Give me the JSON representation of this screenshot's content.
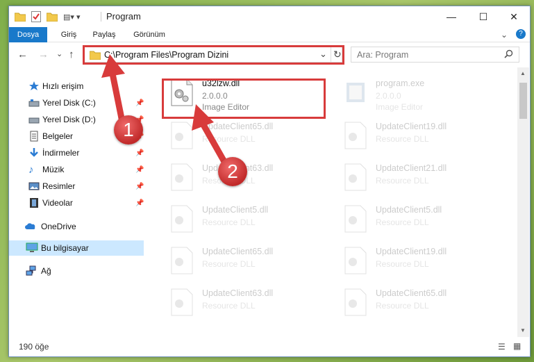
{
  "window": {
    "title": "Program",
    "controls": {
      "minimize": "—",
      "maximize": "☐",
      "close": "✕"
    }
  },
  "ribbon": {
    "tabs": [
      "Dosya",
      "Giriş",
      "Paylaş",
      "Görünüm"
    ]
  },
  "navigation": {
    "back": "←",
    "forward": "→",
    "recent": "⌄",
    "up": "↑"
  },
  "address": {
    "path": "C:\\Program Files\\Program Dizini",
    "dropdown": "⌄",
    "refresh": "↻"
  },
  "search": {
    "placeholder": "Ara: Program"
  },
  "sidebar": {
    "items": [
      {
        "label": "Hızlı erişim",
        "icon": "star-icon"
      },
      {
        "label": "Yerel Disk (C:)",
        "icon": "drive-icon",
        "pinned": true
      },
      {
        "label": "Yerel Disk (D:)",
        "icon": "drive-icon",
        "pinned": true
      },
      {
        "label": "Belgeler",
        "icon": "document-icon",
        "pinned": true
      },
      {
        "label": "İndirmeler",
        "icon": "download-icon",
        "pinned": true
      },
      {
        "label": "Müzik",
        "icon": "music-icon",
        "pinned": true
      },
      {
        "label": "Resimler",
        "icon": "pictures-icon",
        "pinned": true
      },
      {
        "label": "Videolar",
        "icon": "video-icon",
        "pinned": true
      },
      {
        "label": "OneDrive",
        "icon": "cloud-icon"
      },
      {
        "label": "Bu bilgisayar",
        "icon": "computer-icon",
        "selected": true
      },
      {
        "label": "Ağ",
        "icon": "network-icon"
      }
    ]
  },
  "files": [
    {
      "name": "u32lzw.dll",
      "line2": "2.0.0.0",
      "line3": "Image Editor",
      "highlighted": true
    },
    {
      "name": "program.exe",
      "line2": "2.0.0.0",
      "line3": "Image Editor"
    },
    {
      "name": "UpdateClient65.dll",
      "line2": "Resource DLL"
    },
    {
      "name": "UpdateClient19.dll",
      "line2": "Resource DLL"
    },
    {
      "name": "UpdateClient63.dll",
      "line2": "Resource DLL"
    },
    {
      "name": "UpdateClient21.dll",
      "line2": "Resource DLL"
    },
    {
      "name": "UpdateClient5.dll",
      "line2": "Resource DLL"
    },
    {
      "name": "UpdateClient5.dll",
      "line2": "Resource DLL"
    },
    {
      "name": "UpdateClient65.dll",
      "line2": "Resource DLL"
    },
    {
      "name": "UpdateClient19.dll",
      "line2": "Resource DLL"
    },
    {
      "name": "UpdateClient63.dll",
      "line2": "Resource DLL"
    },
    {
      "name": "UpdateClient65.dll",
      "line2": "Resource DLL"
    }
  ],
  "status": {
    "count": "190 öğe"
  },
  "annotations": {
    "step1": "1",
    "step2": "2"
  },
  "colors": {
    "accent": "#1979ca",
    "highlight_box": "#d83b3b",
    "selected": "#cce8ff"
  }
}
